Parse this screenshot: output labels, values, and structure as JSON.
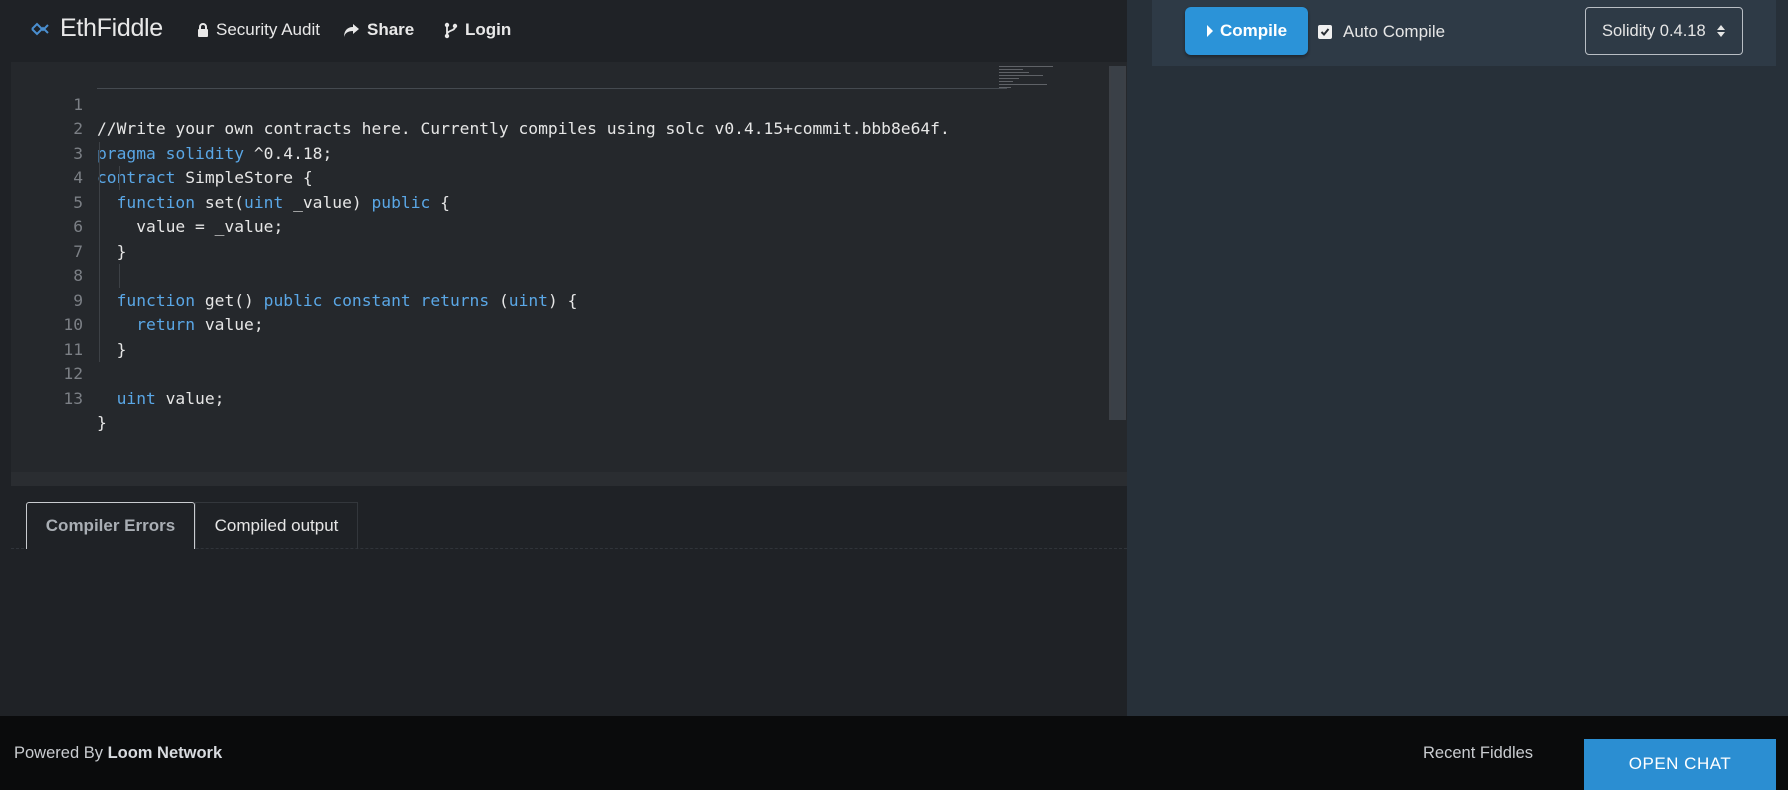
{
  "app": {
    "brand_name": "EthFiddle",
    "brand_icon": "infinity-logo-icon"
  },
  "nav": {
    "security_audit": "Security Audit",
    "share": "Share",
    "login": "Login"
  },
  "editor": {
    "language": "solidity",
    "lines": [
      {
        "n": "1",
        "text": "//Write your own contracts here. Currently compiles using solc v0.4.15+commit.bbb8e64f."
      },
      {
        "n": "2",
        "text": "pragma solidity ^0.4.18;"
      },
      {
        "n": "3",
        "text": "contract SimpleStore {"
      },
      {
        "n": "4",
        "text": "  function set(uint _value) public {"
      },
      {
        "n": "5",
        "text": "    value = _value;"
      },
      {
        "n": "6",
        "text": "  }"
      },
      {
        "n": "7",
        "text": ""
      },
      {
        "n": "8",
        "text": "  function get() public constant returns (uint) {"
      },
      {
        "n": "9",
        "text": "    return value;"
      },
      {
        "n": "10",
        "text": "  }"
      },
      {
        "n": "11",
        "text": ""
      },
      {
        "n": "12",
        "text": "  uint value;"
      },
      {
        "n": "13",
        "text": "}"
      }
    ]
  },
  "console": {
    "tabs": [
      {
        "label": "Compiler Errors",
        "active": true
      },
      {
        "label": "Compiled output",
        "active": false
      }
    ]
  },
  "toolbar": {
    "compile_label": "Compile",
    "auto_compile_label": "Auto Compile",
    "auto_compile_checked": true,
    "version_selected": "Solidity 0.4.18"
  },
  "footer": {
    "powered_by": "Powered By",
    "powered_brand": "Loom Network",
    "recent_fiddles": "Recent Fiddles",
    "open_chat": "OPEN CHAT"
  },
  "colors": {
    "accent": "#2b93d8",
    "keyword": "#5aa7e6",
    "comment": "#8a8e94",
    "background": "#1f2226",
    "right_panel": "#273039"
  }
}
